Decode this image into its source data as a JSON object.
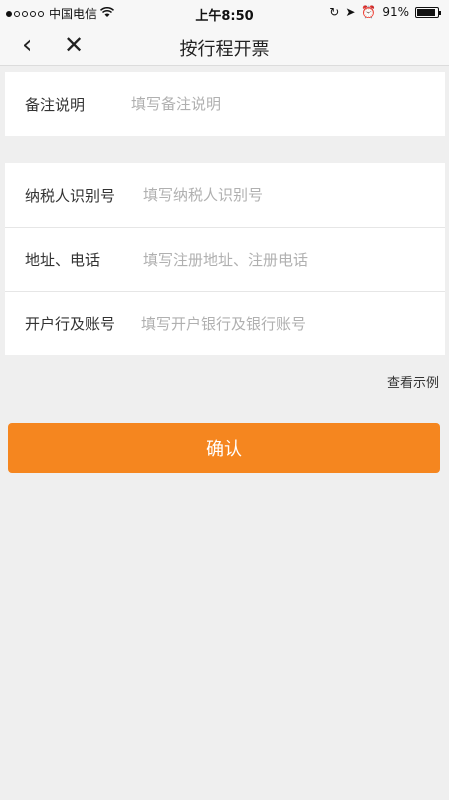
{
  "status_bar": {
    "carrier": "中国电信",
    "time": "上午8:50",
    "battery": "91%",
    "battery_level": 0.91,
    "signal_dots_filled": 1,
    "signal_dots_total": 5
  },
  "nav": {
    "back_icon": "chevron-left-icon",
    "close_icon": "close-icon",
    "title": "按行程开票"
  },
  "remarks": {
    "label": "备注说明",
    "placeholder": "填写备注说明"
  },
  "invoice_fields": [
    {
      "label": "纳税人识别号",
      "placeholder": "填写纳税人识别号"
    },
    {
      "label": "地址、电话",
      "placeholder": "填写注册地址、注册电话"
    },
    {
      "label": "开户行及账号",
      "placeholder": "填写开户银行及银行账号"
    }
  ],
  "example_link": "查看示例",
  "confirm_label": "确认",
  "colors": {
    "accent": "#f5861f",
    "background": "#efefef"
  }
}
